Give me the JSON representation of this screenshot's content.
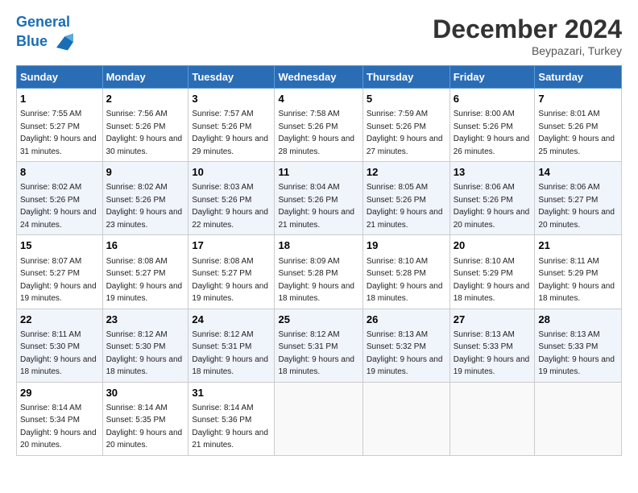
{
  "header": {
    "logo_line1": "General",
    "logo_line2": "Blue",
    "month": "December 2024",
    "location": "Beypazari, Turkey"
  },
  "days_of_week": [
    "Sunday",
    "Monday",
    "Tuesday",
    "Wednesday",
    "Thursday",
    "Friday",
    "Saturday"
  ],
  "weeks": [
    [
      {
        "day": "1",
        "sunrise": "Sunrise: 7:55 AM",
        "sunset": "Sunset: 5:27 PM",
        "daylight": "Daylight: 9 hours and 31 minutes."
      },
      {
        "day": "2",
        "sunrise": "Sunrise: 7:56 AM",
        "sunset": "Sunset: 5:26 PM",
        "daylight": "Daylight: 9 hours and 30 minutes."
      },
      {
        "day": "3",
        "sunrise": "Sunrise: 7:57 AM",
        "sunset": "Sunset: 5:26 PM",
        "daylight": "Daylight: 9 hours and 29 minutes."
      },
      {
        "day": "4",
        "sunrise": "Sunrise: 7:58 AM",
        "sunset": "Sunset: 5:26 PM",
        "daylight": "Daylight: 9 hours and 28 minutes."
      },
      {
        "day": "5",
        "sunrise": "Sunrise: 7:59 AM",
        "sunset": "Sunset: 5:26 PM",
        "daylight": "Daylight: 9 hours and 27 minutes."
      },
      {
        "day": "6",
        "sunrise": "Sunrise: 8:00 AM",
        "sunset": "Sunset: 5:26 PM",
        "daylight": "Daylight: 9 hours and 26 minutes."
      },
      {
        "day": "7",
        "sunrise": "Sunrise: 8:01 AM",
        "sunset": "Sunset: 5:26 PM",
        "daylight": "Daylight: 9 hours and 25 minutes."
      }
    ],
    [
      {
        "day": "8",
        "sunrise": "Sunrise: 8:02 AM",
        "sunset": "Sunset: 5:26 PM",
        "daylight": "Daylight: 9 hours and 24 minutes."
      },
      {
        "day": "9",
        "sunrise": "Sunrise: 8:02 AM",
        "sunset": "Sunset: 5:26 PM",
        "daylight": "Daylight: 9 hours and 23 minutes."
      },
      {
        "day": "10",
        "sunrise": "Sunrise: 8:03 AM",
        "sunset": "Sunset: 5:26 PM",
        "daylight": "Daylight: 9 hours and 22 minutes."
      },
      {
        "day": "11",
        "sunrise": "Sunrise: 8:04 AM",
        "sunset": "Sunset: 5:26 PM",
        "daylight": "Daylight: 9 hours and 21 minutes."
      },
      {
        "day": "12",
        "sunrise": "Sunrise: 8:05 AM",
        "sunset": "Sunset: 5:26 PM",
        "daylight": "Daylight: 9 hours and 21 minutes."
      },
      {
        "day": "13",
        "sunrise": "Sunrise: 8:06 AM",
        "sunset": "Sunset: 5:26 PM",
        "daylight": "Daylight: 9 hours and 20 minutes."
      },
      {
        "day": "14",
        "sunrise": "Sunrise: 8:06 AM",
        "sunset": "Sunset: 5:27 PM",
        "daylight": "Daylight: 9 hours and 20 minutes."
      }
    ],
    [
      {
        "day": "15",
        "sunrise": "Sunrise: 8:07 AM",
        "sunset": "Sunset: 5:27 PM",
        "daylight": "Daylight: 9 hours and 19 minutes."
      },
      {
        "day": "16",
        "sunrise": "Sunrise: 8:08 AM",
        "sunset": "Sunset: 5:27 PM",
        "daylight": "Daylight: 9 hours and 19 minutes."
      },
      {
        "day": "17",
        "sunrise": "Sunrise: 8:08 AM",
        "sunset": "Sunset: 5:27 PM",
        "daylight": "Daylight: 9 hours and 19 minutes."
      },
      {
        "day": "18",
        "sunrise": "Sunrise: 8:09 AM",
        "sunset": "Sunset: 5:28 PM",
        "daylight": "Daylight: 9 hours and 18 minutes."
      },
      {
        "day": "19",
        "sunrise": "Sunrise: 8:10 AM",
        "sunset": "Sunset: 5:28 PM",
        "daylight": "Daylight: 9 hours and 18 minutes."
      },
      {
        "day": "20",
        "sunrise": "Sunrise: 8:10 AM",
        "sunset": "Sunset: 5:29 PM",
        "daylight": "Daylight: 9 hours and 18 minutes."
      },
      {
        "day": "21",
        "sunrise": "Sunrise: 8:11 AM",
        "sunset": "Sunset: 5:29 PM",
        "daylight": "Daylight: 9 hours and 18 minutes."
      }
    ],
    [
      {
        "day": "22",
        "sunrise": "Sunrise: 8:11 AM",
        "sunset": "Sunset: 5:30 PM",
        "daylight": "Daylight: 9 hours and 18 minutes."
      },
      {
        "day": "23",
        "sunrise": "Sunrise: 8:12 AM",
        "sunset": "Sunset: 5:30 PM",
        "daylight": "Daylight: 9 hours and 18 minutes."
      },
      {
        "day": "24",
        "sunrise": "Sunrise: 8:12 AM",
        "sunset": "Sunset: 5:31 PM",
        "daylight": "Daylight: 9 hours and 18 minutes."
      },
      {
        "day": "25",
        "sunrise": "Sunrise: 8:12 AM",
        "sunset": "Sunset: 5:31 PM",
        "daylight": "Daylight: 9 hours and 18 minutes."
      },
      {
        "day": "26",
        "sunrise": "Sunrise: 8:13 AM",
        "sunset": "Sunset: 5:32 PM",
        "daylight": "Daylight: 9 hours and 19 minutes."
      },
      {
        "day": "27",
        "sunrise": "Sunrise: 8:13 AM",
        "sunset": "Sunset: 5:33 PM",
        "daylight": "Daylight: 9 hours and 19 minutes."
      },
      {
        "day": "28",
        "sunrise": "Sunrise: 8:13 AM",
        "sunset": "Sunset: 5:33 PM",
        "daylight": "Daylight: 9 hours and 19 minutes."
      }
    ],
    [
      {
        "day": "29",
        "sunrise": "Sunrise: 8:14 AM",
        "sunset": "Sunset: 5:34 PM",
        "daylight": "Daylight: 9 hours and 20 minutes."
      },
      {
        "day": "30",
        "sunrise": "Sunrise: 8:14 AM",
        "sunset": "Sunset: 5:35 PM",
        "daylight": "Daylight: 9 hours and 20 minutes."
      },
      {
        "day": "31",
        "sunrise": "Sunrise: 8:14 AM",
        "sunset": "Sunset: 5:36 PM",
        "daylight": "Daylight: 9 hours and 21 minutes."
      },
      null,
      null,
      null,
      null
    ]
  ]
}
